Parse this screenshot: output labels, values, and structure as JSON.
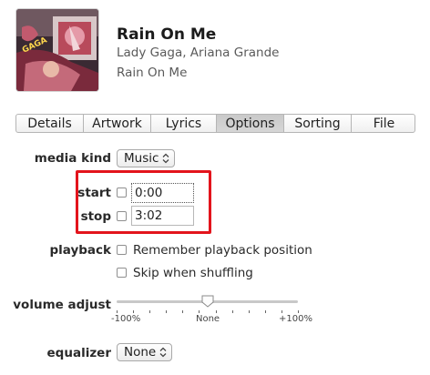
{
  "track": {
    "title": "Rain On Me",
    "artist": "Lady Gaga, Ariana Grande",
    "album": "Rain On Me"
  },
  "tabs": [
    {
      "label": "Details"
    },
    {
      "label": "Artwork"
    },
    {
      "label": "Lyrics"
    },
    {
      "label": "Options",
      "selected": true
    },
    {
      "label": "Sorting"
    },
    {
      "label": "File"
    }
  ],
  "options": {
    "media_kind_label": "media kind",
    "media_kind_value": "Music",
    "start_label": "start",
    "start_value": "0:00",
    "start_checked": false,
    "stop_label": "stop",
    "stop_value": "3:02",
    "stop_checked": false,
    "playback_label": "playback",
    "remember_position_label": "Remember playback position",
    "remember_position_checked": false,
    "skip_shuffling_label": "Skip when shuffling",
    "skip_shuffling_checked": false,
    "volume_label": "volume adjust",
    "volume_min_label": "-100%",
    "volume_mid_label": "None",
    "volume_max_label": "+100%",
    "volume_value_percent": 0,
    "equalizer_label": "equalizer",
    "equalizer_value": "None"
  },
  "colors": {
    "highlight_box": "#e3141c",
    "selected_tab": "#cfcfcf"
  },
  "icons": {
    "select_arrows": "chevron-up-down-icon",
    "slider_thumb": "slider-thumb-icon"
  }
}
